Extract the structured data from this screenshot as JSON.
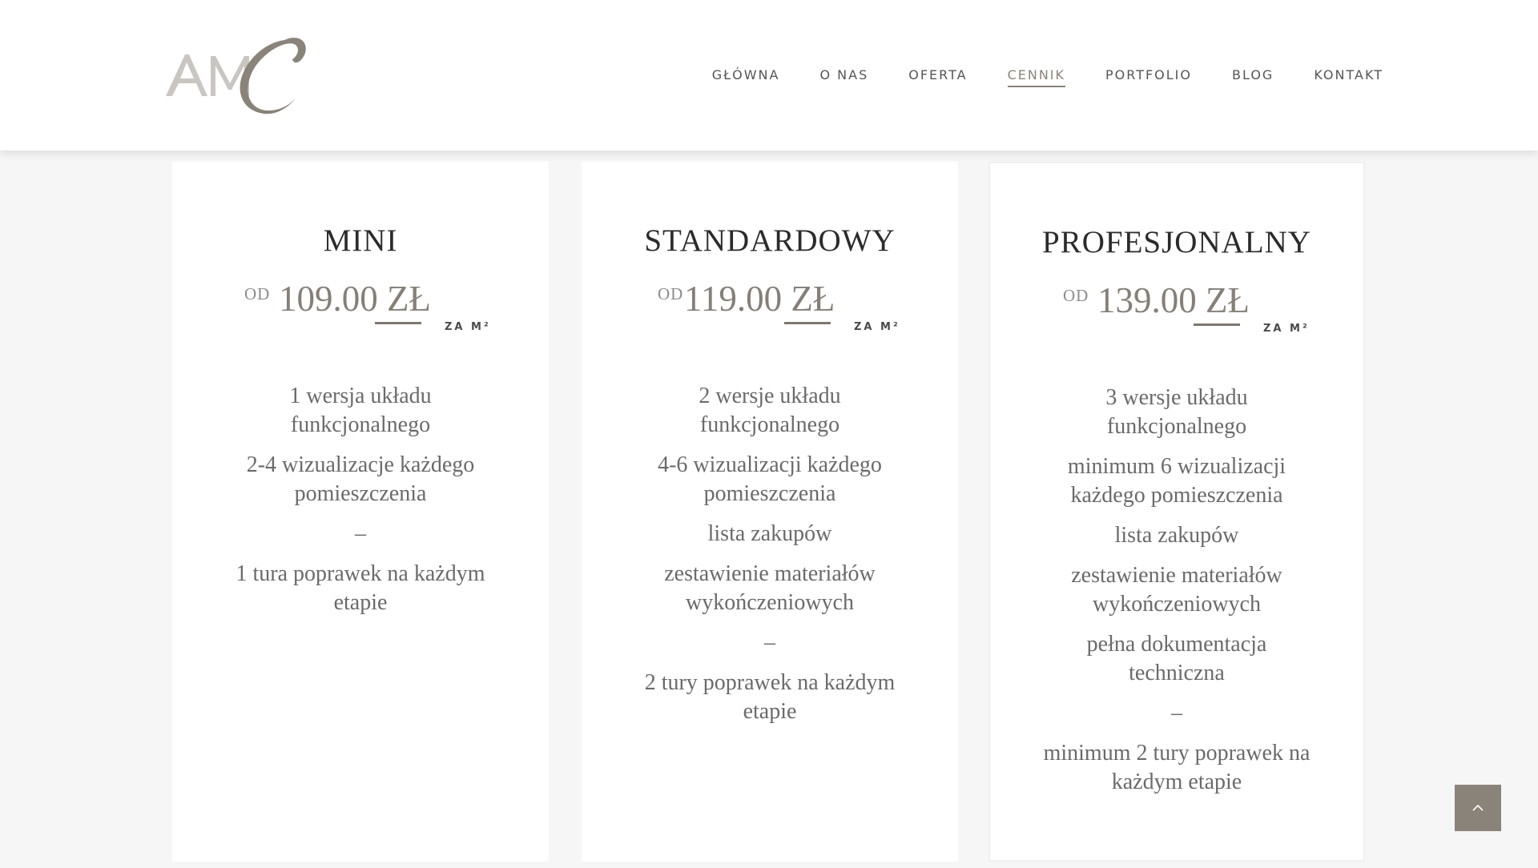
{
  "header": {
    "logo_alt": "AMC",
    "nav": [
      {
        "label": "GŁÓWNA",
        "active": false
      },
      {
        "label": "O NAS",
        "active": false
      },
      {
        "label": "OFERTA",
        "active": false
      },
      {
        "label": "CENNIK",
        "active": true
      },
      {
        "label": "PORTFOLIO",
        "active": false
      },
      {
        "label": "BLOG",
        "active": false
      },
      {
        "label": "KONTAKT",
        "active": false
      }
    ]
  },
  "plans": [
    {
      "title": "MINI",
      "from": "OD",
      "price": "109.00 ZŁ",
      "unit": "ZA M²",
      "features": [
        "1 wersja układu funkcjonalnego",
        "2-4 wizualizacje każdego pomieszczenia",
        "–",
        "1 tura poprawek na każdym etapie"
      ]
    },
    {
      "title": "STANDARDOWY",
      "from": "OD",
      "price": "119.00 ZŁ",
      "unit": "ZA M²",
      "features": [
        "2 wersje układu funkcjonalnego",
        "4-6 wizualizacji każdego pomieszczenia",
        "lista zakupów",
        "zestawienie materiałów wykończeniowych",
        "–",
        "2 tury poprawek na każdym etapie"
      ]
    },
    {
      "title": "PROFESJONALNY",
      "from": "OD",
      "price": "139.00 ZŁ",
      "unit": "ZA M²",
      "features": [
        "3 wersje układu funkcjonalnego",
        "minimum 6 wizualizacji każdego pomieszczenia",
        "lista zakupów",
        "zestawienie materiałów wykończeniowych",
        "pełna dokumentacja techniczna",
        "–",
        "minimum 2 tury poprawek na każdym etapie"
      ]
    }
  ],
  "scroll_top": {
    "icon": "chevron-up-icon"
  },
  "colors": {
    "accent": "#8a837a",
    "background": "#f6f6f6",
    "card": "#ffffff",
    "title": "#2b2b2b",
    "price": "#857f78"
  }
}
